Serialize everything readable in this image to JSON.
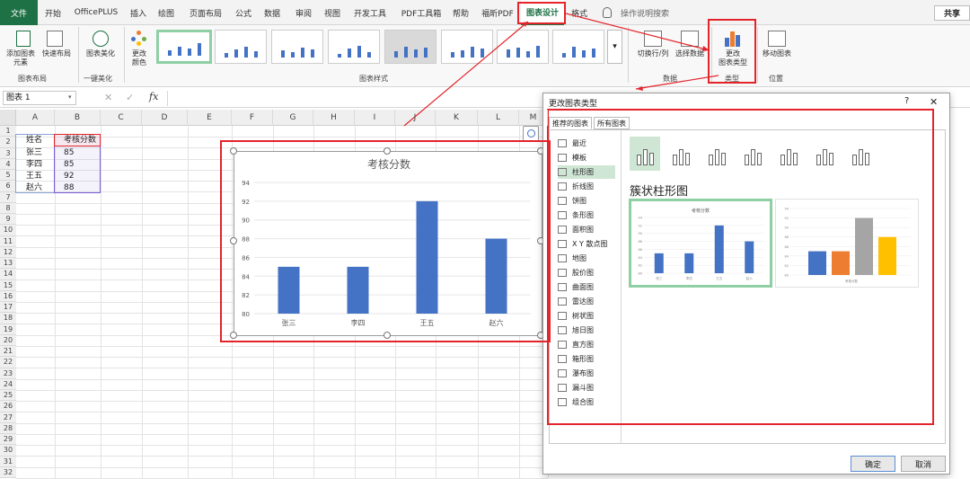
{
  "tabs": {
    "file": "文件",
    "items": [
      "开始",
      "OfficePLUS",
      "插入",
      "绘图",
      "页面布局",
      "公式",
      "数据",
      "审阅",
      "视图",
      "开发工具",
      "PDF工具箱",
      "帮助",
      "福昕PDF",
      "图表设计",
      "格式"
    ],
    "tell_me": "操作说明搜索",
    "share": "共享"
  },
  "ribbon": {
    "add_element_1": "添加图表",
    "add_element_2": "元素",
    "quick_layout": "快速布局",
    "group_layout": "图表布局",
    "beautify": "图表美化",
    "group_beautify": "一键美化",
    "change_color_1": "更改",
    "change_color_2": "颜色",
    "group_styles": "图表样式",
    "switch_row_col": "切换行/列",
    "select_data": "选择数据",
    "group_data": "数据",
    "change_type_1": "更改",
    "change_type_2": "图表类型",
    "group_type": "类型",
    "move_chart": "移动图表",
    "group_location": "位置"
  },
  "formula_bar": {
    "name_box": "图表 1",
    "fx": "fx",
    "cancel": "✕",
    "enter": "✓"
  },
  "sheet": {
    "columns": [
      "A",
      "B",
      "C",
      "D",
      "E",
      "F",
      "G",
      "H",
      "I",
      "J",
      "K",
      "L",
      "M"
    ],
    "rows": [
      "1",
      "2",
      "3",
      "4",
      "5",
      "6",
      "7",
      "8",
      "9",
      "10",
      "11",
      "12",
      "13",
      "14",
      "15",
      "16",
      "17",
      "18",
      "19",
      "20",
      "21",
      "22",
      "23",
      "24",
      "25",
      "26",
      "27",
      "28",
      "29",
      "30",
      "31",
      "32"
    ],
    "header_name": "姓名",
    "header_score": "考核分数",
    "data": [
      {
        "name": "张三",
        "score": "85"
      },
      {
        "name": "李四",
        "score": "85"
      },
      {
        "name": "王五",
        "score": "92"
      },
      {
        "name": "赵六",
        "score": "88"
      }
    ]
  },
  "chart_data": {
    "type": "bar",
    "title": "考核分数",
    "categories": [
      "张三",
      "李四",
      "王五",
      "赵六"
    ],
    "values": [
      85,
      85,
      92,
      88
    ],
    "ylim": [
      80,
      94
    ],
    "yticks": [
      80,
      82,
      84,
      86,
      88,
      90,
      92,
      94
    ],
    "grid": true,
    "color": "#4472c4"
  },
  "dialog": {
    "title": "更改图表类型",
    "help": "?",
    "close": "✕",
    "tab_recommended": "推荐的图表",
    "tab_all": "所有图表",
    "chart_types": [
      "最近",
      "模板",
      "柱形图",
      "折线图",
      "饼图",
      "条形图",
      "面积图",
      "X Y 散点图",
      "地图",
      "股价图",
      "曲面图",
      "雷达图",
      "树状图",
      "旭日图",
      "直方图",
      "箱形图",
      "瀑布图",
      "漏斗图",
      "组合图"
    ],
    "selected_type": "柱形图",
    "subtype_title": "簇状柱形图",
    "ok": "确定",
    "cancel": "取消",
    "preview_colors": [
      "#4472c4",
      "#ed7d31",
      "#a5a5a5",
      "#ffc000"
    ]
  }
}
